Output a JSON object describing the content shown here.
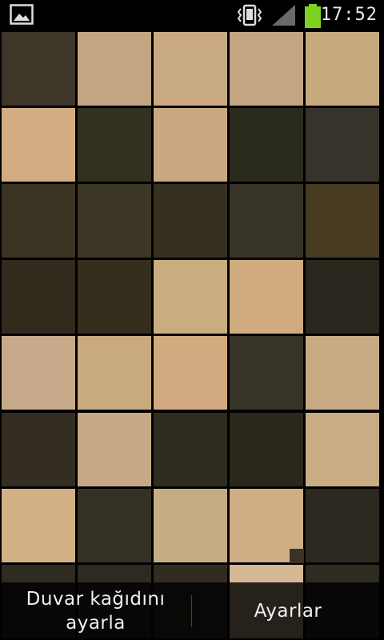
{
  "status_bar": {
    "time": "17:52",
    "icons": [
      "image-notification-icon",
      "vibrate-icon",
      "signal-icon",
      "battery-icon"
    ],
    "battery_color": "#7ed321"
  },
  "tile_grid": {
    "columns": 5,
    "rows": 8,
    "colors": [
      [
        "#3e3628",
        "#c2a681",
        "#c8a982",
        "#c4a582",
        "#c7a97e"
      ],
      [
        "#d4ac81",
        "#33301f",
        "#c9a881",
        "#2b2a1f",
        "#37332a"
      ],
      [
        "#3a3323",
        "#3b3626",
        "#363020",
        "#373326",
        "#473b22"
      ],
      [
        "#312a1d",
        "#352e1e",
        "#c9ac7f",
        "#d0ab7d",
        "#2c271e"
      ],
      [
        "#c6aa8a",
        "#c9aa7f",
        "#d1aa80",
        "#373327",
        "#c8aa83"
      ],
      [
        "#342e22",
        "#c7a885",
        "#2e2c1f",
        "#2a271c",
        "#c8ac83"
      ],
      [
        "#d3af84",
        "#353126",
        "#c5ac83",
        "#d1ad86",
        "#2c2920"
      ],
      [
        "#302b20",
        "#2e2a20",
        "#302c21",
        "#d4b793",
        "#2e2b20"
      ]
    ]
  },
  "bottom_bar": {
    "set_wallpaper_line1": "Duvar kağıdını",
    "set_wallpaper_line2": "ayarla",
    "settings_label": "Ayarlar"
  }
}
